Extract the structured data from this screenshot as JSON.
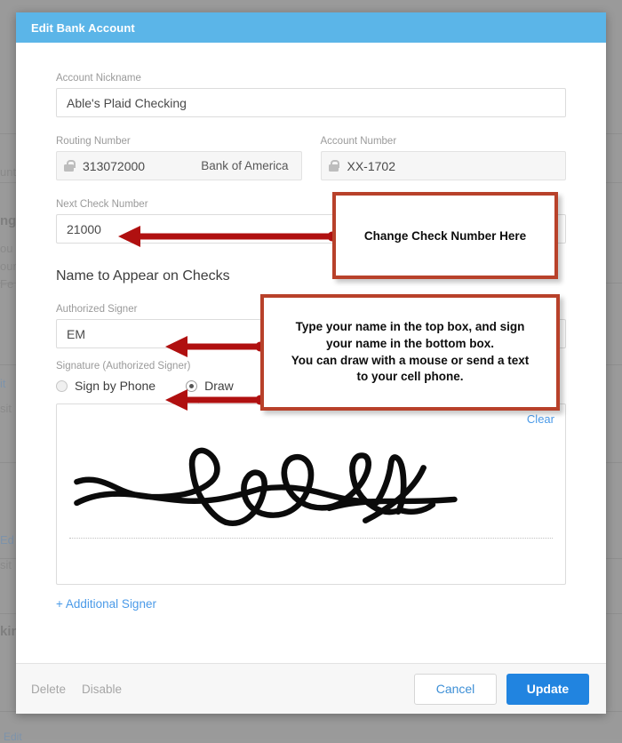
{
  "modal": {
    "title": "Edit Bank Account",
    "fields": {
      "nickname_label": "Account Nickname",
      "nickname_value": "Able's Plaid Checking",
      "routing_label": "Routing Number",
      "routing_value": "313072000",
      "routing_bank": "Bank of America",
      "account_label": "Account Number",
      "account_value": "XX-1702",
      "check_label": "Next Check Number",
      "check_value": "21000",
      "signer_label": "Authorized Signer",
      "signer_value": "EM",
      "signature_label": "Signature (Authorized Signer)"
    },
    "section_title": "Name to Appear on Checks",
    "radios": [
      {
        "label": "Sign by Phone",
        "checked": false
      },
      {
        "label": "Draw",
        "checked": true
      }
    ],
    "clear_label": "Clear",
    "add_signer_label": "+ Additional Signer",
    "footer": {
      "delete_label": "Delete",
      "disable_label": "Disable",
      "cancel_label": "Cancel",
      "update_label": "Update"
    }
  },
  "annotations": [
    {
      "id": "anno-1",
      "text": "Change Check Number Here"
    },
    {
      "id": "anno-2",
      "line1": "Type your name in the top box, and sign",
      "line2": "your name in the bottom box.",
      "line3": "You can draw with a mouse or send a text",
      "line4": "to your cell phone."
    }
  ],
  "background": {
    "t1": "unts",
    "t2": "ng",
    "t3": "ou",
    "t4": "oun",
    "t5": "Fe",
    "t6": "it",
    "t7": "sit",
    "t8": "Ed",
    "t9": "sit",
    "t10": "kin",
    "t11": "Edit"
  },
  "colors": {
    "header": "#5bb5e8",
    "primary": "#2184e0",
    "link": "#4a9ae8",
    "annotation_border": "#b8412a",
    "arrow": "#b01010",
    "backdrop": "#9a9a9a"
  }
}
